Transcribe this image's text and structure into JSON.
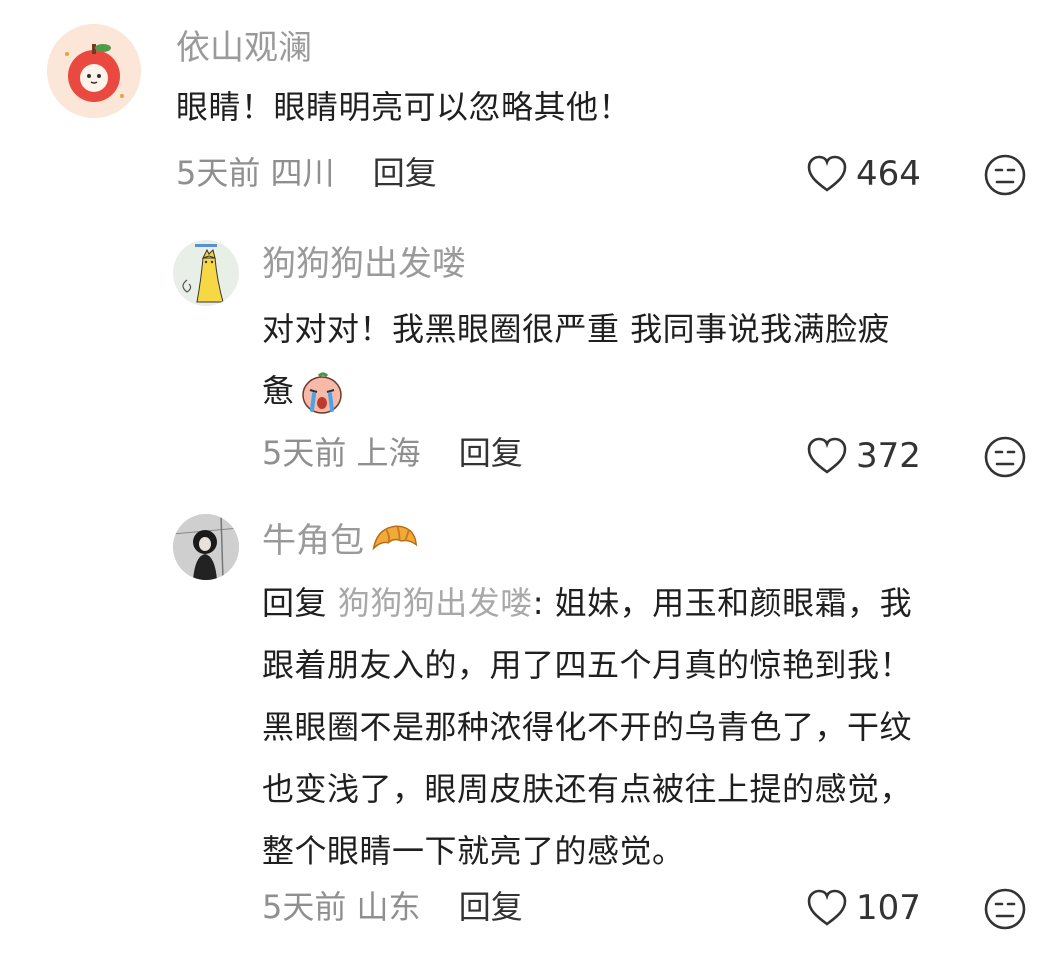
{
  "comments": [
    {
      "user": "依山观澜",
      "text": "眼睛！眼睛明亮可以忽略其他！",
      "days": "5天前",
      "location": "四川",
      "reply_label": "回复",
      "likes": "464",
      "avatar": "apple-cat-avatar"
    },
    {
      "user": "狗狗狗出发喽",
      "text_line1": "对对对！我黑眼圈很严重 我同事说我满脸疲",
      "text_line2": "惫",
      "emoji": "crying-face-emoji",
      "days": "5天前",
      "location": "上海",
      "reply_label": "回复",
      "likes": "372",
      "avatar": "yellow-cat-avatar"
    },
    {
      "user": "牛角包",
      "user_emoji": "croissant-emoji",
      "reply_prefix": "回复",
      "reply_to": "狗狗狗出发喽",
      "lines": [
        ": 姐妹，用玉和颜眼霜，我",
        "跟着朋友入的，用了四五个月真的惊艳到我！",
        "黑眼圈不是那种浓得化不开的乌青色了，干纹",
        "也变浅了，眼周皮肤还有点被往上提的感觉，",
        "整个眼睛一下就亮了的感觉。"
      ],
      "days": "5天前",
      "location": "山东",
      "reply_label": "回复",
      "likes": "107",
      "avatar": "girl-photo-avatar"
    }
  ]
}
